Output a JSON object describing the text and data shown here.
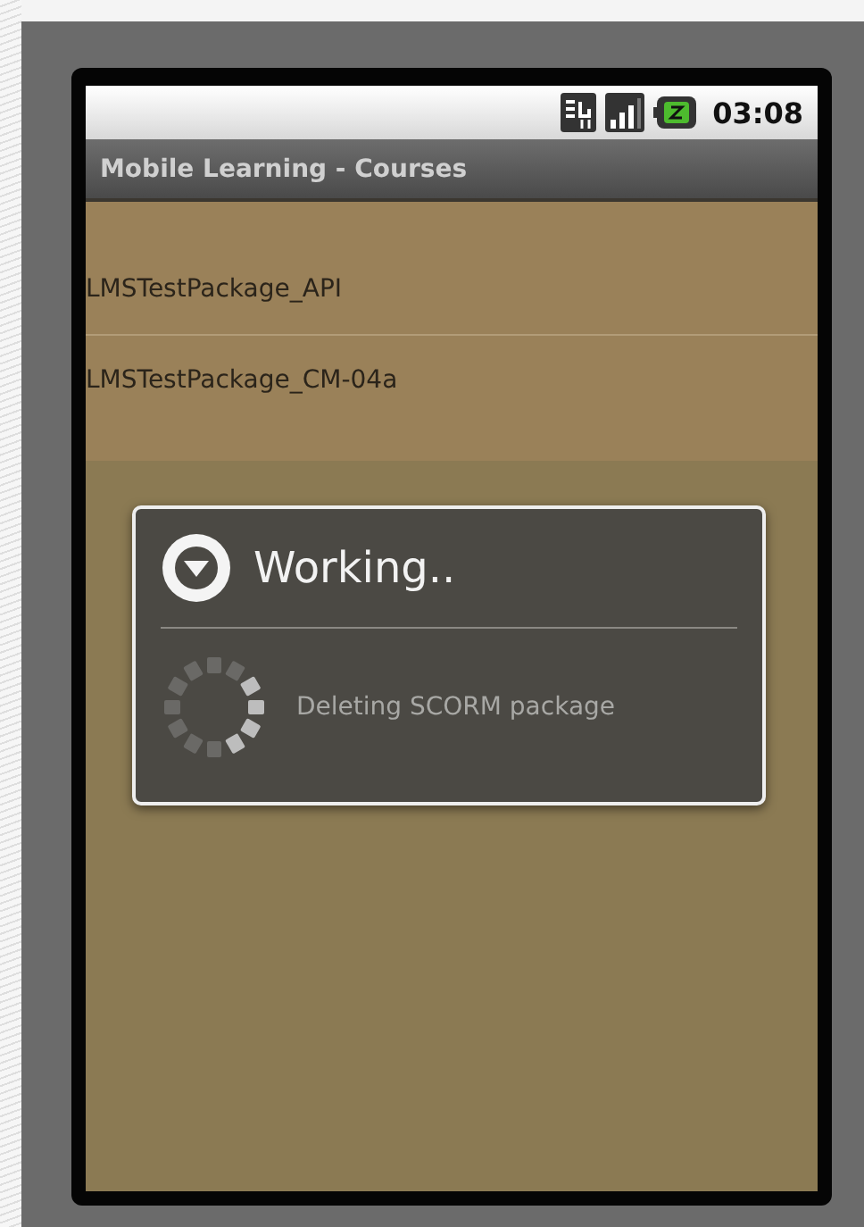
{
  "status_bar": {
    "time": "03:08"
  },
  "title_bar": {
    "title": "Mobile Learning - Courses"
  },
  "courses": [
    {
      "name": "LMSTestPackage_API"
    },
    {
      "name": "LMSTestPackage_CM-04a"
    }
  ],
  "dialog": {
    "title": "Working..",
    "message": "Deleting SCORM package"
  }
}
